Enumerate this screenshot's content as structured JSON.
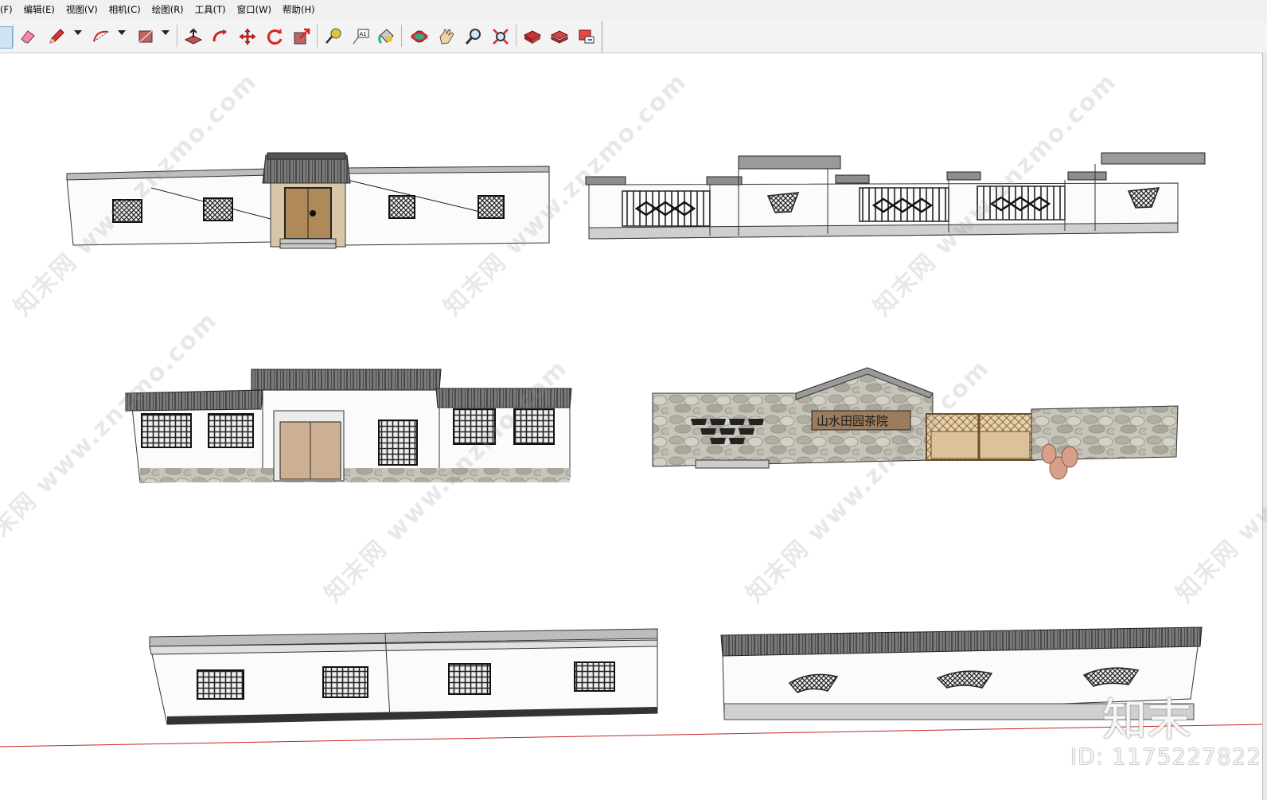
{
  "menu": {
    "items": [
      "(F)",
      "编辑(E)",
      "视图(V)",
      "相机(C)",
      "绘图(R)",
      "工具(T)",
      "窗口(W)",
      "帮助(H)"
    ]
  },
  "toolbar": {
    "tools": [
      "select-icon",
      "eraser-icon",
      "pencil-icon",
      "arc-icon",
      "rectangle-icon",
      "push-pull-icon",
      "follow-me-icon",
      "move-icon",
      "rotate-icon",
      "scale-icon",
      "tape-measure-icon",
      "text-icon",
      "paint-bucket-icon",
      "orbit-icon",
      "pan-icon",
      "zoom-icon",
      "zoom-extents-icon",
      "warehouse-icon",
      "extension-icon",
      "share-model-icon"
    ]
  },
  "scene": {
    "models": [
      "wall-with-gate-tile-roof",
      "wall-with-iron-fences",
      "courtyard-front-facade",
      "stone-wall-signboard",
      "long-wall-lattice-windows",
      "long-wall-tile-coping-fan-windows"
    ],
    "signboard_text": "山水田园茶院"
  },
  "watermark": {
    "text": "知末网 www.znzmo.com",
    "logo": "知末",
    "id": "ID: 1175227822"
  },
  "colors": {
    "toolbar_bg": "#f3f3f3",
    "wall_white": "#fbfbfb",
    "roof_dark": "#555555",
    "stone": "#b8b6ad",
    "wood": "#c9a77d",
    "axis_red": "#c22"
  }
}
